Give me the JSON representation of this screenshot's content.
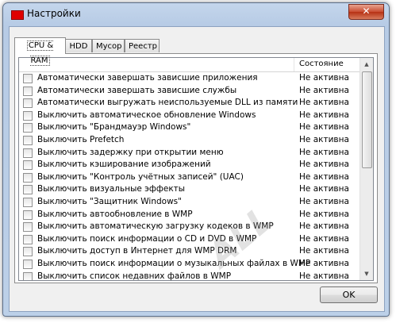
{
  "window": {
    "title": "Настройки",
    "close_glyph": "✕",
    "accent_color": "#e00000"
  },
  "tabs": [
    {
      "label": "CPU & RAM",
      "active": true
    },
    {
      "label": "HDD",
      "active": false
    },
    {
      "label": "Мусор",
      "active": false
    },
    {
      "label": "Реестр",
      "active": false
    }
  ],
  "list": {
    "header_status": "Состояние",
    "rows": [
      {
        "label": "Автоматически завершать зависшие приложения",
        "status": "Не активна",
        "checked": false
      },
      {
        "label": "Автоматически завершать зависшие службы",
        "status": "Не активна",
        "checked": false
      },
      {
        "label": "Автоматически выгружать неиспользуемые DLL из памяти",
        "status": "Не активна",
        "checked": false
      },
      {
        "label": "Выключить автоматическое обновление Windows",
        "status": "Не активна",
        "checked": false
      },
      {
        "label": "Выключить \"Брандмауэр Windows\"",
        "status": "Не активна",
        "checked": false
      },
      {
        "label": "Выключить Prefetch",
        "status": "Не активна",
        "checked": false
      },
      {
        "label": "Выключить задержку при открытии меню",
        "status": "Не активна",
        "checked": false
      },
      {
        "label": "Выключить кэширование изображений",
        "status": "Не активна",
        "checked": false
      },
      {
        "label": "Выключить \"Контроль учётных записей\" (UAC)",
        "status": "Не активна",
        "checked": false
      },
      {
        "label": "Выключить визуальные эффекты",
        "status": "Не активна",
        "checked": false
      },
      {
        "label": "Выключить \"Защитник Windows\"",
        "status": "Не активна",
        "checked": false
      },
      {
        "label": "Выключить автообновление в WMP",
        "status": "Не активна",
        "checked": false
      },
      {
        "label": "Выключить автоматическую загрузку кодеков в WMP",
        "status": "Не активна",
        "checked": false
      },
      {
        "label": "Выключить поиск информации о CD и DVD в WMP",
        "status": "Не активна",
        "checked": false
      },
      {
        "label": "Выключить доступ в Интернет для WMP DRM",
        "status": "Не активна",
        "checked": false
      },
      {
        "label": "Выключить поиск информации о музыкальных файлах в WMP",
        "status": "Не активна",
        "checked": false
      },
      {
        "label": "Выключить список недавних файлов в WMP",
        "status": "Не активна",
        "checked": false
      }
    ]
  },
  "scrollbar": {
    "up_glyph": "▲",
    "down_glyph": "▼"
  },
  "ok_label": "OK",
  "watermark": "ALL"
}
